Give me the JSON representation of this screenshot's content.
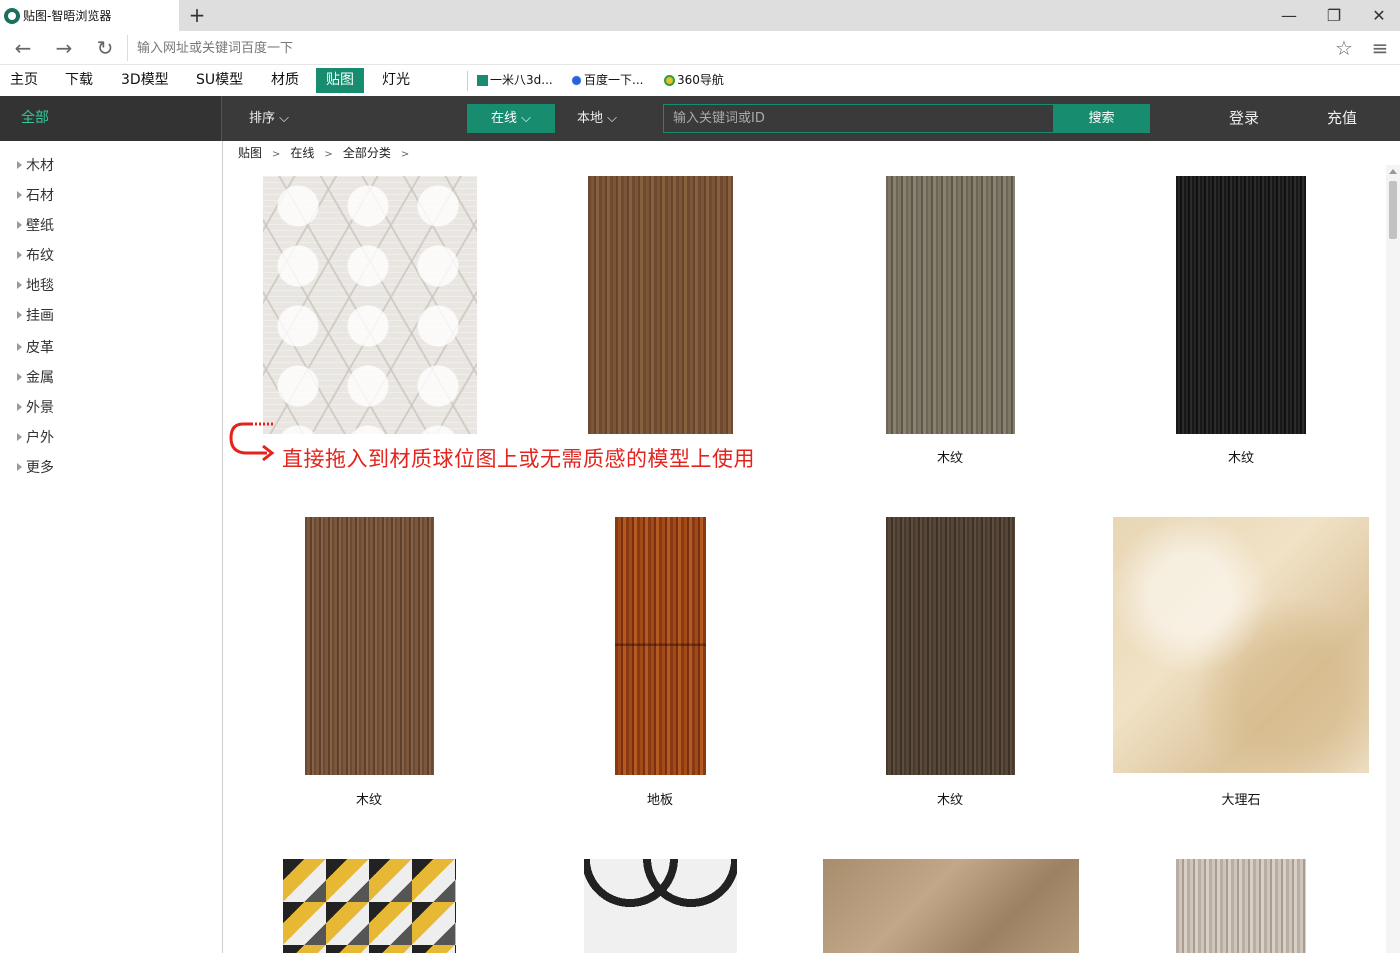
{
  "browser": {
    "tab_title": "贴图-智晤浏览器",
    "new_tab": "+",
    "url_placeholder": "输入网址或关键词百度一下",
    "window_controls": {
      "minimize": "—",
      "restore": "❐",
      "close": "✕"
    },
    "nav": {
      "back": "←",
      "forward": "→",
      "reload": "↻",
      "star": "☆",
      "menu": "≡"
    }
  },
  "app_tabs": [
    "主页",
    "下载",
    "3D模型",
    "SU模型",
    "材质",
    "贴图",
    "灯光"
  ],
  "active_tab": "贴图",
  "bookmarks": [
    {
      "label": "一米八3d...",
      "icon": "yimiba-icon"
    },
    {
      "label": "百度一下...",
      "icon": "baidu-icon"
    },
    {
      "label": "360导航",
      "icon": "360-icon"
    }
  ],
  "header": {
    "all_label": "全部",
    "sort_label": "排序",
    "online_label": "在线",
    "local_label": "本地",
    "search_placeholder": "输入关键词或ID",
    "search_button": "搜索",
    "login": "登录",
    "recharge": "充值",
    "chevron": "⌵"
  },
  "categories": [
    "木材",
    "石材",
    "壁纸",
    "布纹",
    "地毯",
    "挂画",
    "皮革",
    "金属",
    "外景",
    "户外",
    "更多"
  ],
  "breadcrumb": {
    "items": [
      "贴图",
      "在线",
      "全部分类"
    ],
    "separator": ">"
  },
  "textures": [
    {
      "label": "",
      "style": "pattern"
    },
    {
      "label": "",
      "style": "wood1"
    },
    {
      "label": "木纹",
      "style": "wood2"
    },
    {
      "label": "木纹",
      "style": "wood3"
    },
    {
      "label": "木纹",
      "style": "wood4"
    },
    {
      "label": "地板",
      "style": "floor"
    },
    {
      "label": "木纹",
      "style": "wood5"
    },
    {
      "label": "大理石",
      "style": "marble"
    },
    {
      "label": "",
      "style": "chevron"
    },
    {
      "label": "",
      "style": "arches"
    },
    {
      "label": "",
      "style": "stone"
    },
    {
      "label": "",
      "style": "travertine"
    }
  ],
  "annotation": {
    "text": "直接拖入到材质球位图上或无需质感的模型上使用",
    "color": "#e4231c"
  },
  "colors": {
    "accent": "#188c6f",
    "accent_text": "#31c99a",
    "header_bg": "#3a3a3a"
  }
}
